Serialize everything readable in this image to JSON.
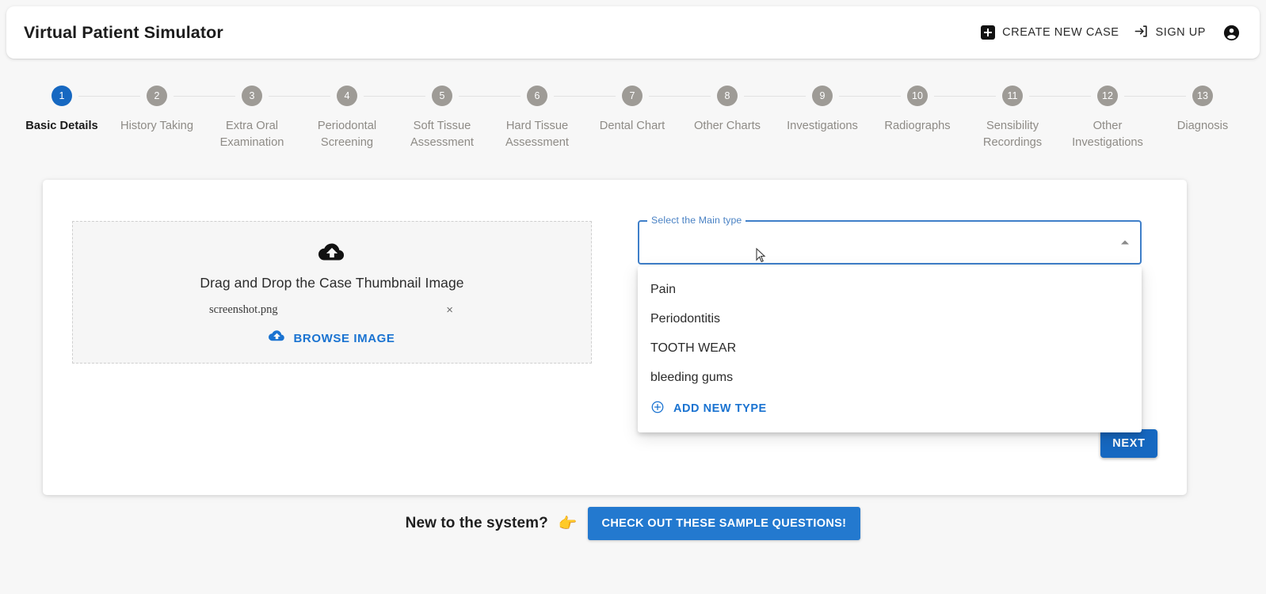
{
  "header": {
    "brand": "Virtual Patient Simulator",
    "create_case_label": "CREATE NEW CASE",
    "create_case_icon": "plus-box-icon",
    "sign_up_label": "SIGN UP",
    "sign_up_icon": "login-arrow-icon",
    "avatar_icon": "account-circle-icon"
  },
  "stepper": {
    "active_index": 1,
    "steps": [
      {
        "number": "1",
        "label": "Basic Details"
      },
      {
        "number": "2",
        "label": "History Taking"
      },
      {
        "number": "3",
        "label": "Extra Oral Examination"
      },
      {
        "number": "4",
        "label": "Periodontal Screening"
      },
      {
        "number": "5",
        "label": "Soft Tissue Assessment"
      },
      {
        "number": "6",
        "label": "Hard Tissue Assessment"
      },
      {
        "number": "7",
        "label": "Dental Chart"
      },
      {
        "number": "8",
        "label": "Other Charts"
      },
      {
        "number": "9",
        "label": "Investigations"
      },
      {
        "number": "10",
        "label": "Radiographs"
      },
      {
        "number": "11",
        "label": "Sensibility Recordings"
      },
      {
        "number": "12",
        "label": "Other Investigations"
      },
      {
        "number": "13",
        "label": "Diagnosis"
      }
    ]
  },
  "dropzone": {
    "upload_icon": "cloud-upload-icon",
    "title": "Drag and Drop the Case Thumbnail Image",
    "file_name": "screenshot.png",
    "remove_icon": "close-icon",
    "browse_icon": "cloud-upload-icon",
    "browse_label": "BROWSE IMAGE"
  },
  "main_type_select": {
    "legend": "Select the Main type",
    "value": "",
    "placeholder": "",
    "caret_icon": "chevron-up-icon",
    "expanded": true,
    "options": [
      "Pain",
      "Periodontitis",
      "TOOTH WEAR",
      "bleeding gums"
    ],
    "add_new_label": "ADD NEW TYPE",
    "add_new_icon": "plus-circle-icon"
  },
  "actions": {
    "next_label": "NEXT"
  },
  "footer": {
    "prompt": "New to the system?",
    "hand_icon": "pointing-right-hand-icon",
    "hand_glyph": "👉",
    "cta_label": "CHECK OUT THESE SAMPLE QUESTIONS!"
  },
  "colors": {
    "accent_blue": "#1668c1",
    "link_blue": "#1a73d1",
    "cta_blue": "#2379cf",
    "step_inactive": "#9e9b96",
    "page_bg": "#f7f7f7"
  }
}
